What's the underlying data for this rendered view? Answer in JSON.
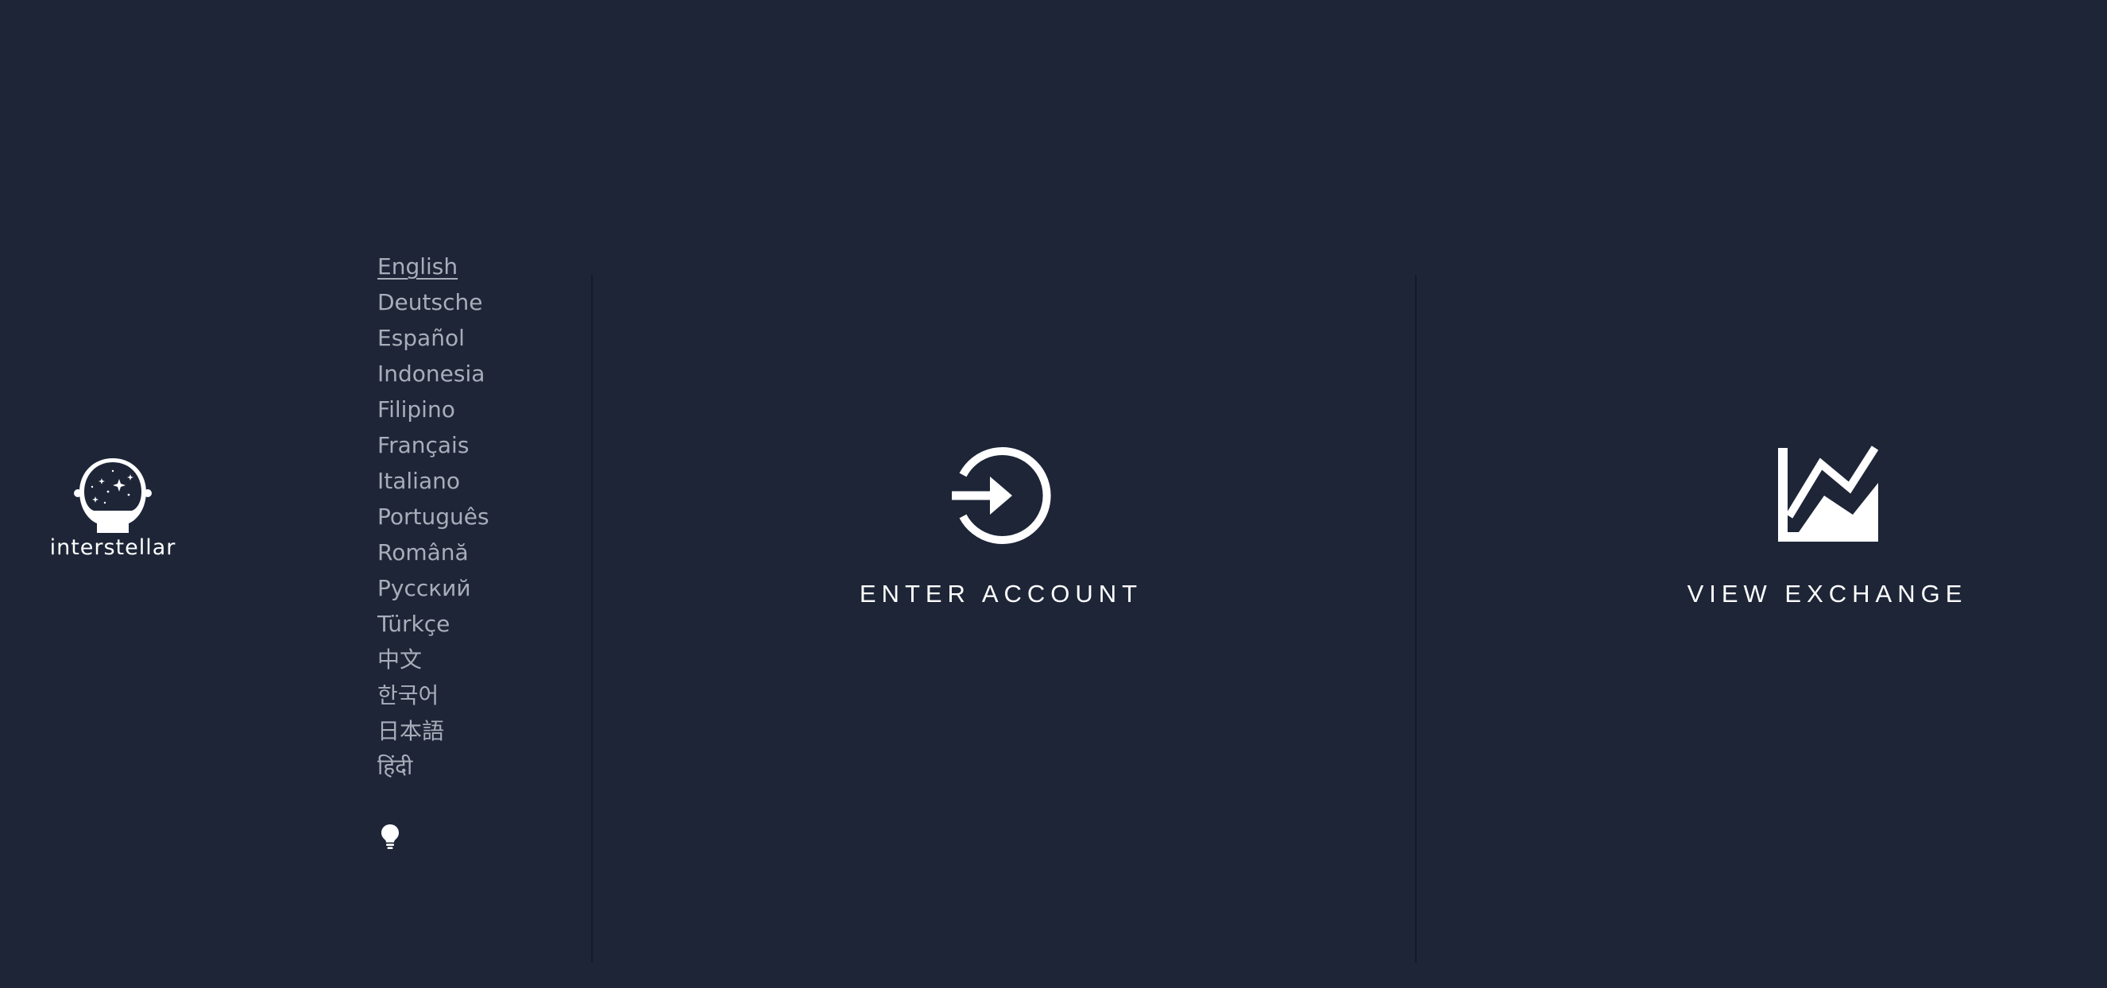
{
  "brand": {
    "name": "interstellar",
    "icon": "astronaut-helmet-icon"
  },
  "languages": {
    "selected": "English",
    "items": [
      "English",
      "Deutsche",
      "Español",
      "Indonesia",
      "Filipino",
      "Français",
      "Italiano",
      "Português",
      "Română",
      "Русский",
      "Türkçe",
      "中文",
      "한국어",
      "日本語",
      "हिंदी"
    ]
  },
  "theme_toggle": {
    "icon": "lightbulb-icon"
  },
  "actions": {
    "enter_account": {
      "label": "ENTER ACCOUNT",
      "icon": "login-arrow-circle-icon"
    },
    "view_exchange": {
      "label": "VIEW EXCHANGE",
      "icon": "chart-line-icon"
    }
  },
  "colors": {
    "background": "#1d2537",
    "text": "#ffffff",
    "muted_text": "#a8adb9",
    "divider": "#141a28"
  }
}
